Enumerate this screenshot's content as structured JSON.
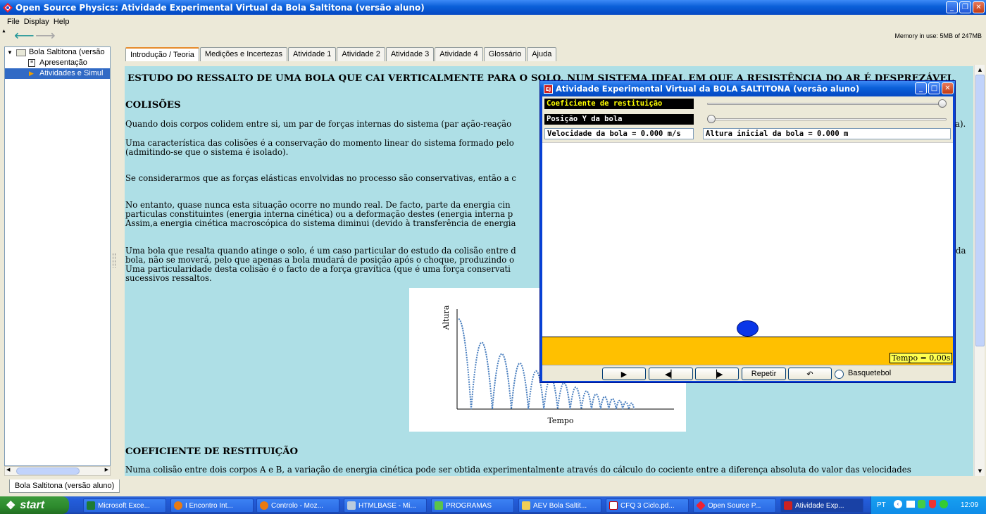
{
  "window": {
    "title": "Open Source Physics: Atividade Experimental Virtual da Bola Saltitona (versão aluno)"
  },
  "menu": [
    "File",
    "Display",
    "Help"
  ],
  "toolbar": {
    "back_icon": "arrow-left-icon",
    "forward_icon": "arrow-right-icon",
    "memory": "Memory in use: 5MB of 247MB"
  },
  "tree": {
    "root": "Bola Saltitona (versão",
    "items": [
      "Apresentação",
      "Atividades e Simul"
    ]
  },
  "tabs": [
    "Introdução / Teoria",
    "Medições e Incertezas",
    "Atividade 1",
    "Atividade 2",
    "Atividade 3",
    "Atividade 4",
    "Glossário",
    "Ajuda"
  ],
  "content": {
    "heading": "ESTUDO DO RESSALTO DE UMA BOLA QUE CAI VERTICALMENTE PARA O SOLO, NUM SISTEMA IDEAL EM QUE A RESISTÊNCIA DO AR É DESPREZÁVEL",
    "section1": "COLISÕES",
    "p1": "Quando dois corpos colidem entre si, um par de forças internas do sistema (par ação-reação",
    "p1_end": "a).",
    "p2a": "Uma característica das colisões é a conservação do momento linear do sistema formado pelo",
    "p2b": "(admitindo-se que o sistema é isolado).",
    "p3": "Se considerarmos que as forças elásticas envolvidas no processo são conservativas, então a c",
    "p4a": "No entanto, quase nunca esta situação ocorre no mundo real. De facto, parte da energia cin",
    "p4b": "particulas constituintes (energia interna cinética) ou a deformação destes (energia interna p",
    "p4c": "Assim,a energia cinética macroscópica do sistema diminui (devido à transferência de energia",
    "p5a": "Uma bola que resalta quando atinge o solo, é um caso particular do estudo da colisão entre d",
    "p5a_end": "da",
    "p5b": "bola, não se moverá, pelo que apenas a bola mudará de posição após o choque, produzindo o",
    "p5c": "Uma particularidade desta colisão é o facto de a força gravítica (que é uma força conservati",
    "p5d": "sucessivos ressaltos.",
    "section2": "COEFICIENTE DE RESTITUIÇÃO",
    "p6": "Numa colisão entre dois corpos A e B, a variação de energia cinética pode ser obtida experimentalmente através do cálculo do cociente entre a diferença absoluta do valor das velocidades"
  },
  "graph": {
    "ylabel": "Altura",
    "xlabel": "Tempo",
    "color": "#4a7fbf"
  },
  "bottom_tab": "Bola Saltitona (versão aluno)",
  "dialog": {
    "title": "Atividade Experimental Virtual da  BOLA SALTITONA (versão aluno)",
    "coef_label": "Coeficiente de restituição",
    "coef_value": 1.0,
    "posy_label": "Posição Y da bola",
    "posy_value": 0.0,
    "velocity": "Velocidade da bola = 0.000 m/s",
    "height": "Altura inicial da bola = 0.000 m",
    "tempo": "Tempo = 0,00s",
    "buttons": {
      "play_icon": "play-icon",
      "step_back_icon": "step-back-icon",
      "step_forward_icon": "step-forward-icon",
      "repeat": "Repetir",
      "reset_icon": "reset-icon"
    },
    "radio_label": "Basquetebol",
    "floor_color": "#ffc000",
    "ball_color": "#0a36e8"
  },
  "taskbar": {
    "start": "start",
    "tasks": [
      "Microsoft Exce...",
      "I Encontro Int...",
      "Controlo - Moz...",
      "HTMLBASE - Mi...",
      "PROGRAMAS",
      "AEV Bola Saltit...",
      "CFQ 3 Ciclo.pd...",
      "Open Source P...",
      "Atividade Exp..."
    ],
    "lang": "PT",
    "clock": "12:09"
  }
}
